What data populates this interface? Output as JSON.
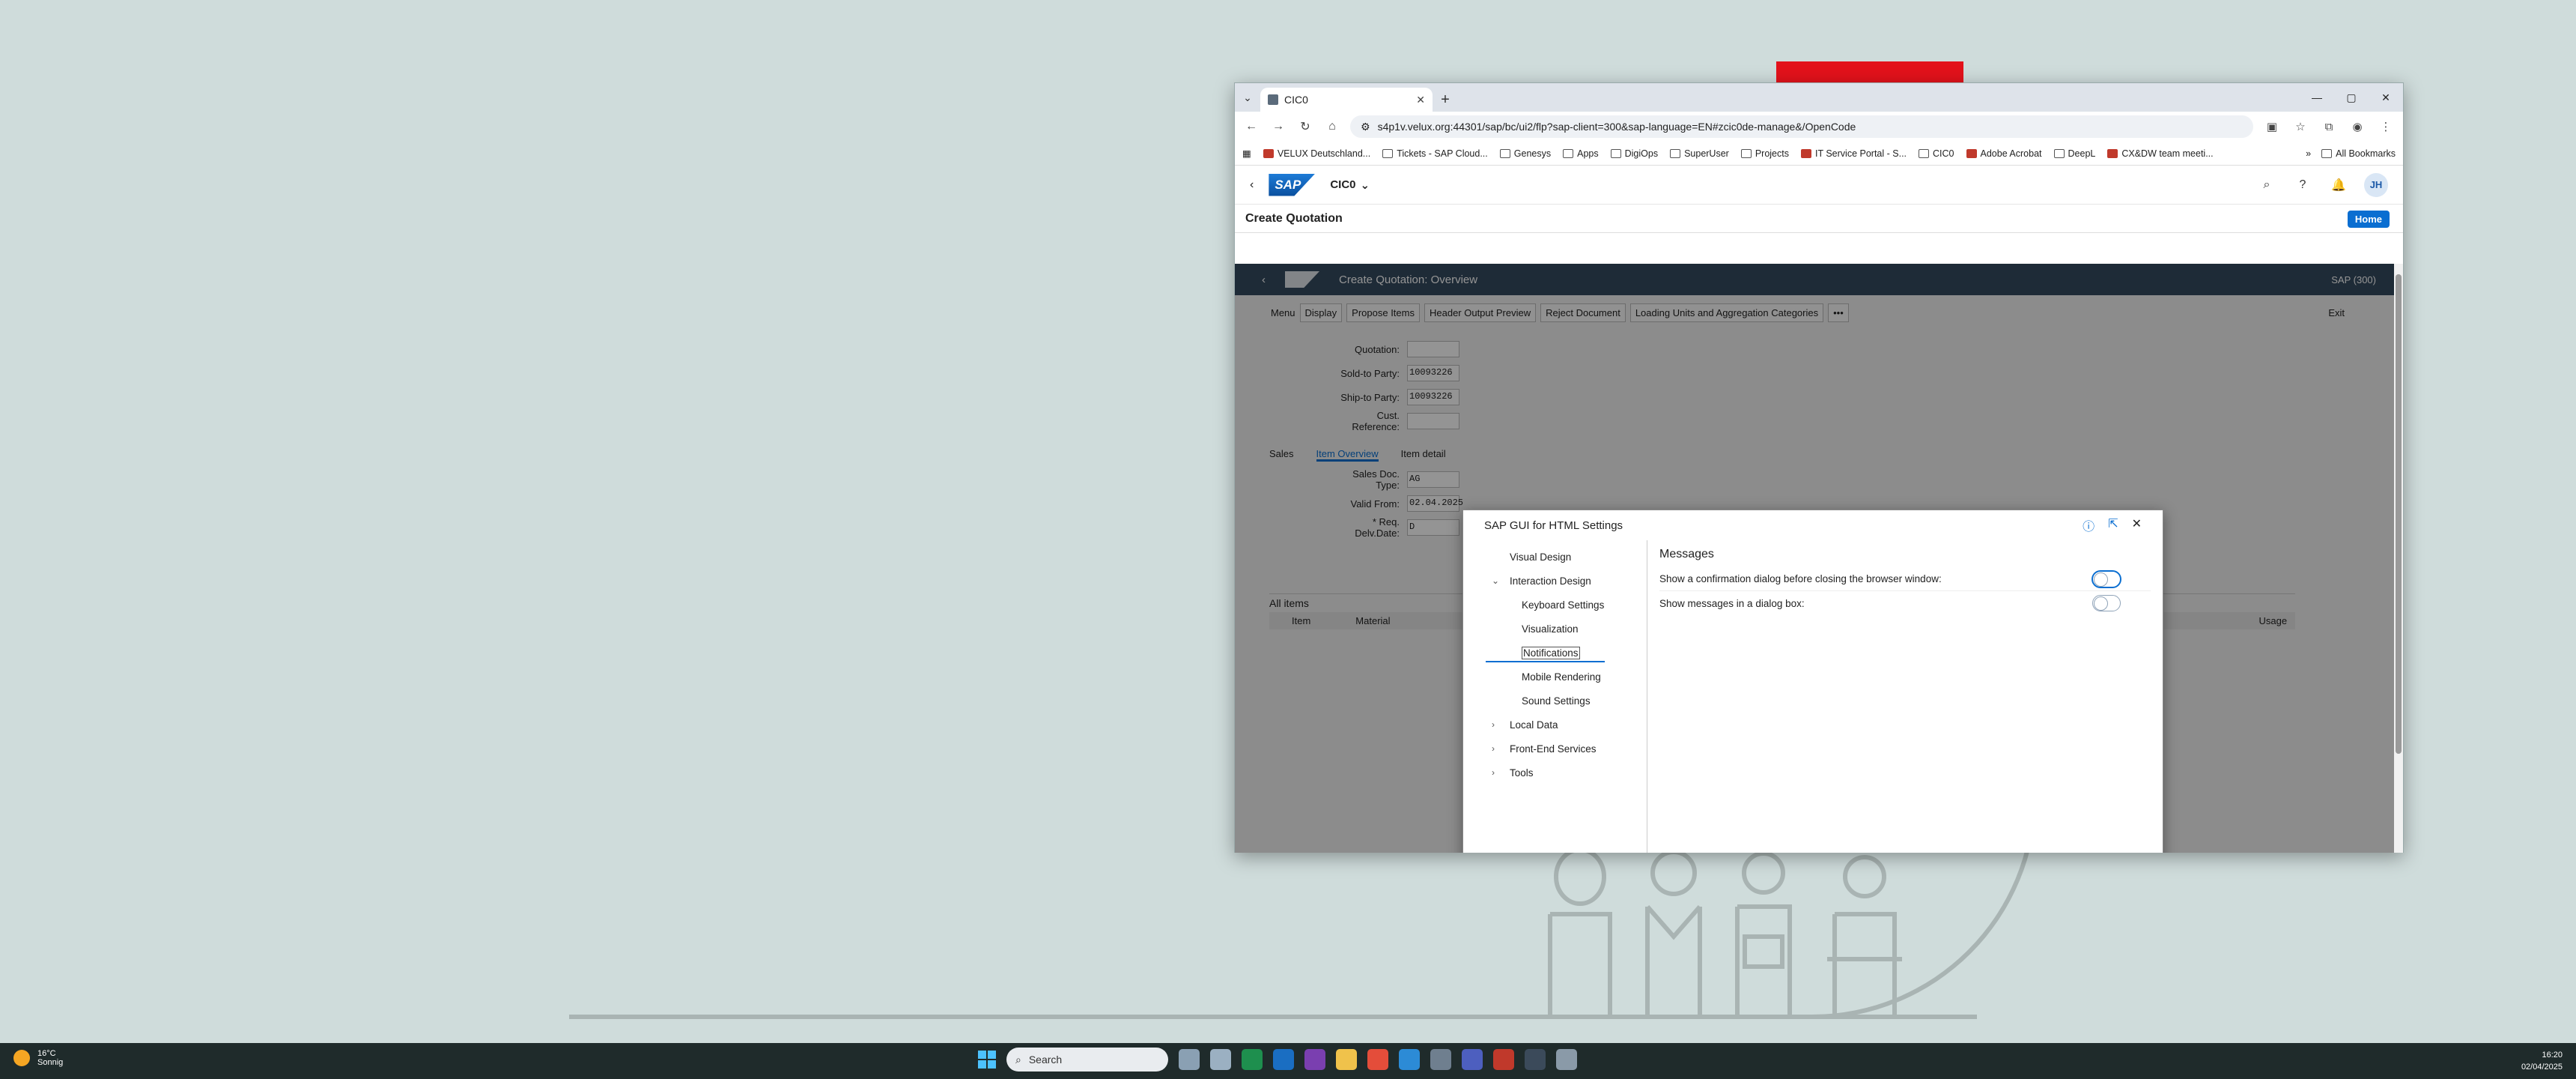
{
  "browser": {
    "tab_title": "CIC0",
    "url": "s4p1v.velux.org:44301/sap/bc/ui2/flp?sap-client=300&sap-language=EN#zcic0de-manage&/OpenCode",
    "bookmarks": [
      "VELUX Deutschland...",
      "Tickets - SAP Cloud...",
      "Genesys",
      "Apps",
      "DigiOps",
      "SuperUser",
      "Projects",
      "IT Service Portal - S...",
      "CIC0",
      "Adobe Acrobat",
      "DeepL",
      "CX&DW team meeti..."
    ],
    "all_bookmarks": "All Bookmarks"
  },
  "shell": {
    "logo": "SAP",
    "app_title": "CIC0",
    "avatar": "JH",
    "page_title": "Create Quotation",
    "home": "Home"
  },
  "gui": {
    "title": "Create Quotation: Overview",
    "system": "SAP (300)",
    "toolbar": [
      "Menu",
      "Display",
      "Propose Items",
      "Header Output Preview",
      "Reject Document",
      "Loading Units and Aggregation Categories",
      "•••"
    ],
    "exit": "Exit",
    "fields": [
      {
        "label": "Quotation:",
        "value": ""
      },
      {
        "label": "Sold-to Party:",
        "value": "10093226"
      },
      {
        "label": "Ship-to Party:",
        "value": "10093226"
      },
      {
        "label": "Cust. Reference:",
        "value": ""
      }
    ],
    "tabs": [
      "Sales",
      "Item Overview",
      "Item detail"
    ],
    "fields2": [
      {
        "label": "Sales Doc. Type:",
        "value": "AG"
      },
      {
        "label": "Valid From:",
        "value": "02.04.2025"
      },
      {
        "label": "* Req. Delv.Date:",
        "value": "D"
      }
    ],
    "all_items": "All items",
    "columns": [
      "Item",
      "Material",
      "Usage"
    ]
  },
  "dialog": {
    "title": "SAP GUI for HTML Settings",
    "nav": [
      {
        "label": "Visual Design",
        "level": 1
      },
      {
        "label": "Interaction Design",
        "level": 1,
        "expanded": true
      },
      {
        "label": "Keyboard Settings",
        "level": 2
      },
      {
        "label": "Visualization",
        "level": 2
      },
      {
        "label": "Notifications",
        "level": 2,
        "selected": true
      },
      {
        "label": "Mobile Rendering",
        "level": 2
      },
      {
        "label": "Sound Settings",
        "level": 2
      },
      {
        "label": "Local Data",
        "level": 1,
        "collapsed": true
      },
      {
        "label": "Front-End Services",
        "level": 1,
        "collapsed": true
      },
      {
        "label": "Tools",
        "level": 1,
        "collapsed": true
      }
    ],
    "section": "Messages",
    "settings": [
      {
        "label": "Show a confirmation dialog before closing the browser window:",
        "on": false
      },
      {
        "label": "Show messages in a dialog box:",
        "on": false
      }
    ]
  },
  "taskbar": {
    "temp": "16°C",
    "condition": "Sonnig",
    "search": "Search",
    "time": "16:20",
    "date": "02/04/2025"
  }
}
